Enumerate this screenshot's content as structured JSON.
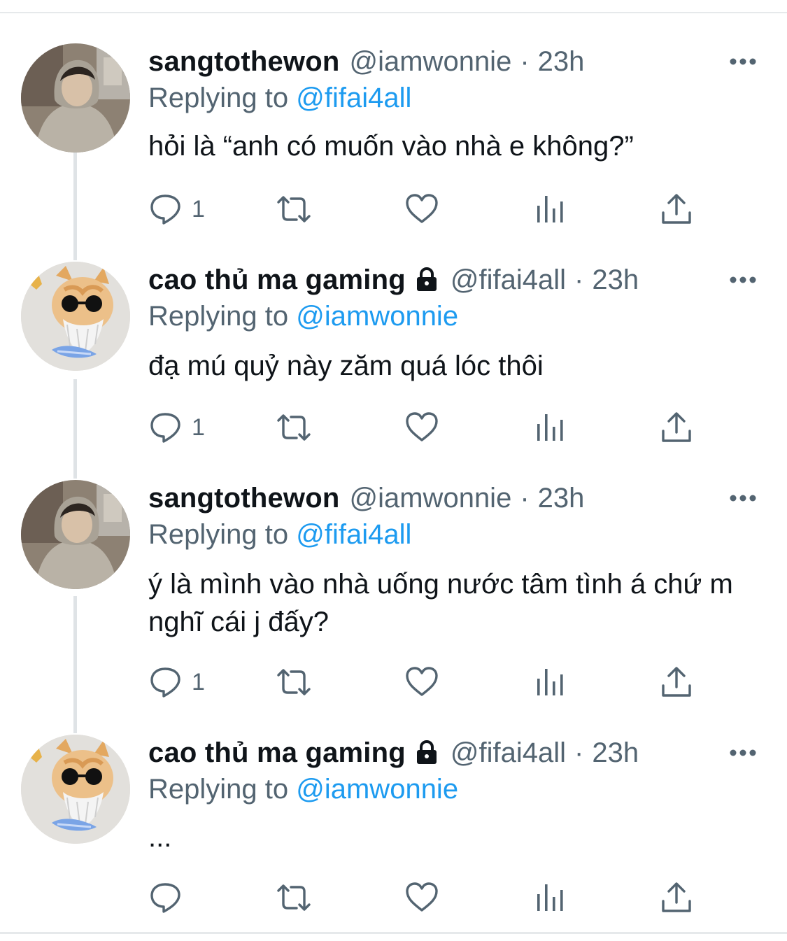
{
  "tweets": [
    {
      "name": "sangtothewon",
      "handle": "@iamwonnie",
      "separator": "·",
      "time": "23h",
      "protected": false,
      "replying_label": "Replying to",
      "replying_to": "@fifai4all",
      "text": "hỏi là “anh có muốn vào nhà e không?”",
      "reply_count": "1"
    },
    {
      "name": "cao thủ ma gaming",
      "handle": "@fifai4all",
      "separator": "·",
      "time": "23h",
      "protected": true,
      "replying_label": "Replying to",
      "replying_to": "@iamwonnie",
      "text": "đạ mú quỷ này zăm quá lóc thôi",
      "reply_count": "1"
    },
    {
      "name": "sangtothewon",
      "handle": "@iamwonnie",
      "separator": "·",
      "time": "23h",
      "protected": false,
      "replying_label": "Replying to",
      "replying_to": "@fifai4all",
      "text": "ý là mình vào nhà uống nước tâm tình á chứ m nghĩ cái j đấy?",
      "reply_count": "1"
    },
    {
      "name": "cao thủ ma gaming",
      "handle": "@fifai4all",
      "separator": "·",
      "time": "23h",
      "protected": true,
      "replying_label": "Replying to",
      "replying_to": "@iamwonnie",
      "text": "...",
      "reply_count": ""
    }
  ],
  "icons": {
    "reply": "speech-bubble-icon",
    "retweet": "retweet-arrows-icon",
    "like": "heart-icon",
    "views": "bar-chart-icon",
    "share": "share-upload-icon",
    "more": "three-dots-icon",
    "lock": "lock-icon"
  },
  "colors": {
    "text": "#0f1419",
    "secondary": "#536471",
    "link": "#1d9bf0",
    "thread_line": "#dfe3e6",
    "divider": "#e6e9eb"
  }
}
